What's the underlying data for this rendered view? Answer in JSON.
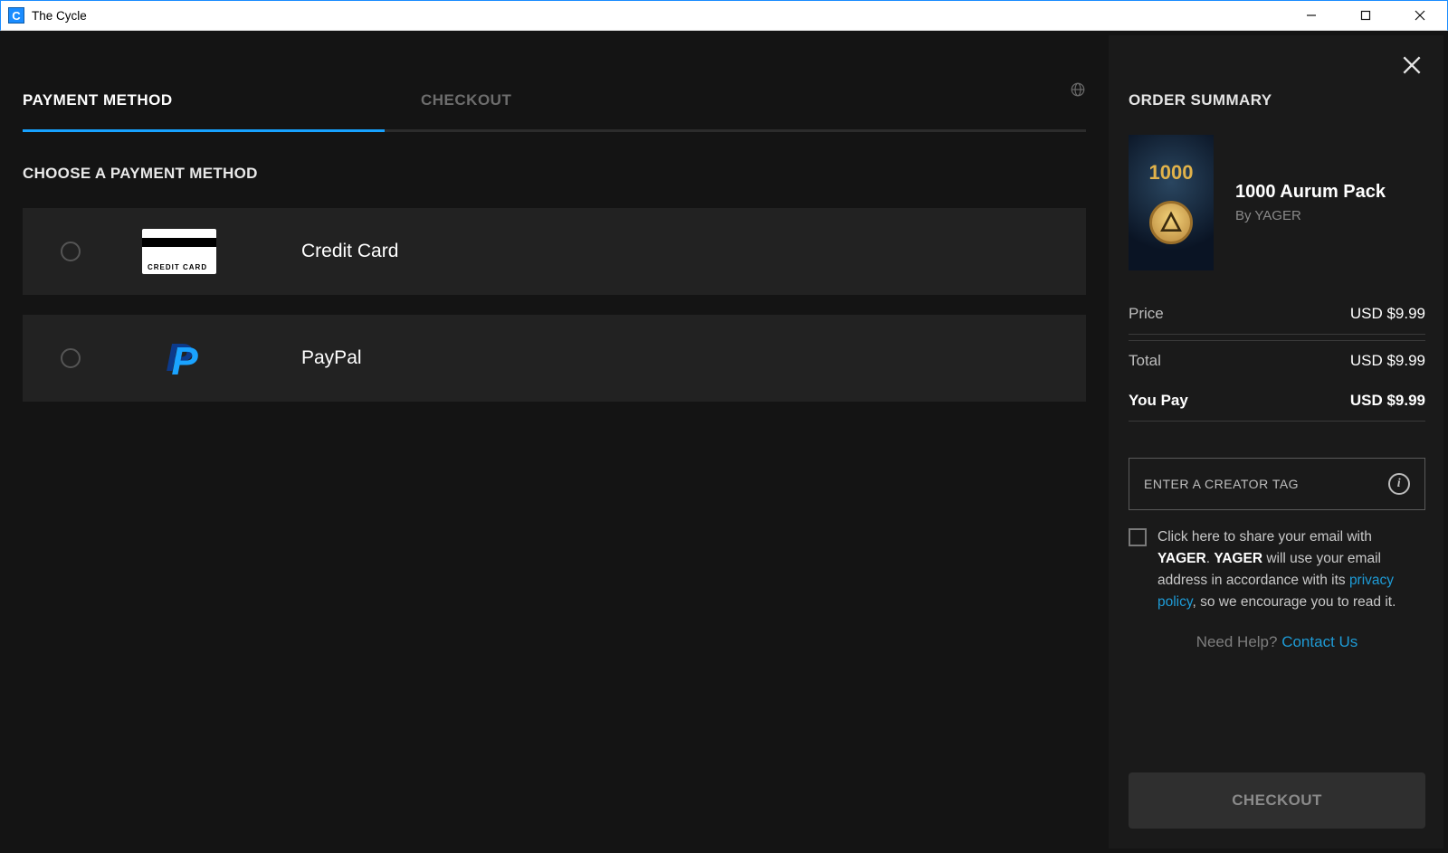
{
  "window": {
    "title": "The Cycle"
  },
  "tabs": {
    "payment_method": "PAYMENT METHOD",
    "checkout": "CHECKOUT"
  },
  "section_title": "CHOOSE A PAYMENT METHOD",
  "payment_methods": [
    {
      "id": "credit-card",
      "label": "Credit Card",
      "card_text": "CREDIT CARD"
    },
    {
      "id": "paypal",
      "label": "PayPal"
    }
  ],
  "order": {
    "heading": "ORDER SUMMARY",
    "product": {
      "thumb_amount": "1000",
      "title": "1000 Aurum Pack",
      "by_prefix": "By ",
      "by": "YAGER"
    },
    "rows": {
      "price_label": "Price",
      "price_value": "USD $9.99",
      "total_label": "Total",
      "total_value": "USD $9.99",
      "youpay_label": "You Pay",
      "youpay_value": "USD $9.99"
    },
    "creator_tag_placeholder": "ENTER A CREATOR TAG",
    "consent": {
      "pre": "Click here to share your email with ",
      "brand": "YAGER",
      "mid1": ". ",
      "mid2": " will use your email address in accordance with its ",
      "privacy": "privacy policy",
      "post": ", so we encourage you to read it."
    },
    "help": {
      "prefix": "Need Help? ",
      "contact": "Contact Us"
    },
    "checkout_button": "CHECKOUT"
  }
}
